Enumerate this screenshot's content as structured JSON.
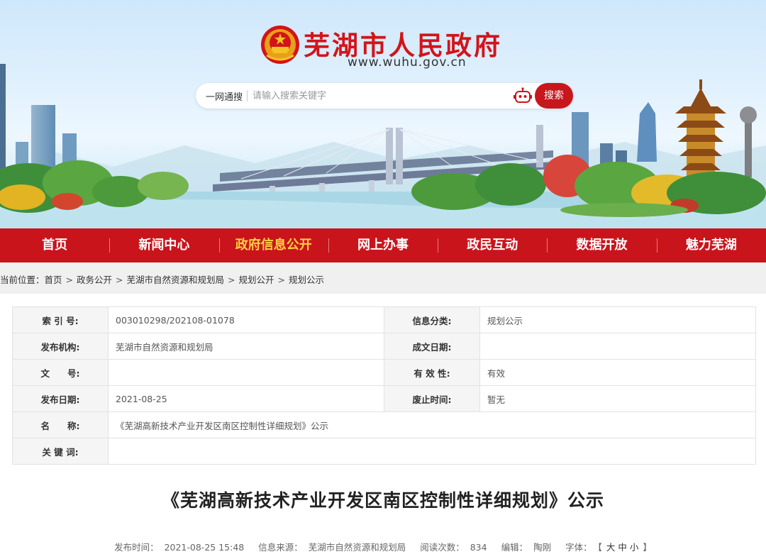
{
  "site": {
    "title": "芜湖市人民政府",
    "url": "www.wuhu.gov.cn"
  },
  "search": {
    "scope": "一网通搜",
    "placeholder": "请输入搜索关键字",
    "button": "搜索"
  },
  "nav": {
    "items": [
      {
        "label": "首页"
      },
      {
        "label": "新闻中心"
      },
      {
        "label": "政府信息公开"
      },
      {
        "label": "网上办事"
      },
      {
        "label": "政民互动"
      },
      {
        "label": "数据开放"
      },
      {
        "label": "魅力芜湖"
      }
    ],
    "active_index": 2,
    "active_color": "#ffd23f"
  },
  "breadcrumb": {
    "prefix": "当前位置：",
    "items": [
      "首页",
      "政务公开",
      "芜湖市自然资源和规划局",
      "规划公开",
      "规划公示"
    ]
  },
  "meta": {
    "index_label": "索 引 号:",
    "index_value": "003010298/202108-01078",
    "category_label": "信息分类:",
    "category_value": "规划公示",
    "org_label": "发布机构:",
    "org_value": "芜湖市自然资源和规划局",
    "written_date_label": "成文日期:",
    "written_date_value": "",
    "doc_no_label": "文　　号:",
    "doc_no_value": "",
    "validity_label": "有 效 性:",
    "validity_value": "有效",
    "publish_date_label": "发布日期:",
    "publish_date_value": "2021-08-25",
    "abolish_label": "废止时间:",
    "abolish_value": "暂无",
    "name_label": "名　　称:",
    "name_value": "《芜湖高新技术产业开发区南区控制性详细规划》公示",
    "keywords_label": "关 键 词:",
    "keywords_value": ""
  },
  "article": {
    "title": "《芜湖高新技术产业开发区南区控制性详细规划》公示",
    "time_label": "发布时间：",
    "time_value": "2021-08-25 15:48",
    "source_label": "信息来源：",
    "source_value": "芜湖市自然资源和规划局",
    "views_label": "阅读次数：",
    "views_value": "834",
    "editor_label": "编辑：",
    "editor_value": "陶刚",
    "font_label": "字体：",
    "font_open": "【",
    "font_large": "大",
    "font_medium": "中",
    "font_small": "小",
    "font_close": "】"
  },
  "colors": {
    "brand_red": "#c9141b",
    "title_red": "#d2141a"
  }
}
